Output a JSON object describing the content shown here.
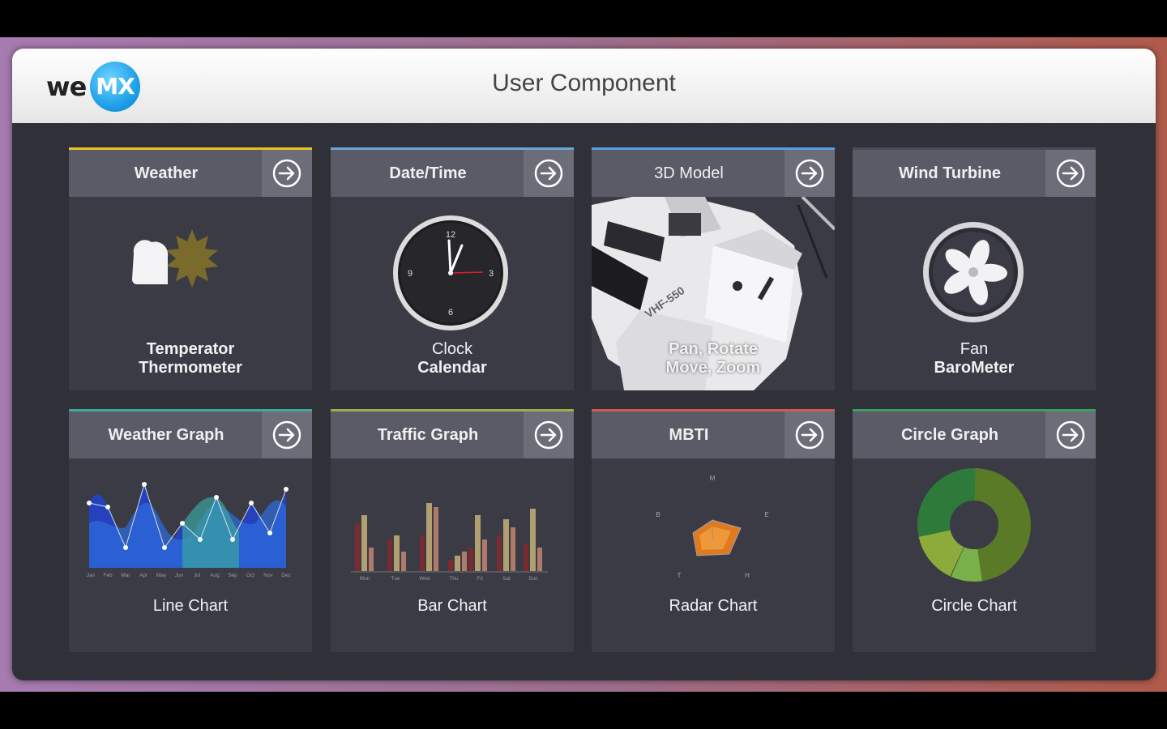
{
  "app": {
    "logo_left": "we",
    "logo_right": "MX",
    "title": "User Component"
  },
  "cards": [
    {
      "title": "Weather",
      "line1": "Temperator",
      "line2": "Thermometer",
      "accent": "#e6c229",
      "icon": "weather-icon"
    },
    {
      "title": "Date/Time",
      "line1": "Clock",
      "line2": "Calendar",
      "accent": "#6aa7d8",
      "icon": "clock-icon"
    },
    {
      "title": "3D Model",
      "line1": "Pan, Rotate",
      "line2": "Move, Zoom",
      "accent": "#5aa0e0",
      "icon": "3d-model-image"
    },
    {
      "title": "Wind Turbine",
      "line1": "Fan",
      "line2": "BaroMeter",
      "accent": "#4a4b55",
      "icon": "fan-icon"
    },
    {
      "title": "Weather Graph",
      "line1": "Line Chart",
      "accent": "#3ea8a0",
      "icon": "line-chart-icon"
    },
    {
      "title": "Traffic Graph",
      "line1": "Bar Chart",
      "accent": "#9ab04a",
      "icon": "bar-chart-icon"
    },
    {
      "title": "MBTI",
      "line1": "Radar Chart",
      "accent": "#d25a4a",
      "icon": "radar-chart-icon"
    },
    {
      "title": "Circle Graph",
      "line1": "Circle Chart",
      "accent": "#3aa060",
      "icon": "circle-chart-icon"
    }
  ],
  "clock": {
    "n12": "12",
    "n3": "3",
    "n6": "6",
    "n9": "9"
  },
  "model": {
    "label": "VHF-550"
  },
  "line_months": [
    "Jan",
    "Feb",
    "Mar",
    "Apr",
    "May",
    "Jun",
    "Jul",
    "Aug",
    "Sep",
    "Oct",
    "Nov",
    "Dec"
  ],
  "bar_days": [
    "Mon",
    "Tue",
    "Wed",
    "Thu",
    "Fri",
    "Sat",
    "Sun"
  ],
  "radar_axes": {
    "top": "M",
    "left": "B",
    "right": "E",
    "bottom_left": "T",
    "bottom_right": "H"
  },
  "colors": {
    "go_arrow": "#ffffff",
    "panel": "#2f3038",
    "card": "#3a3b45"
  }
}
